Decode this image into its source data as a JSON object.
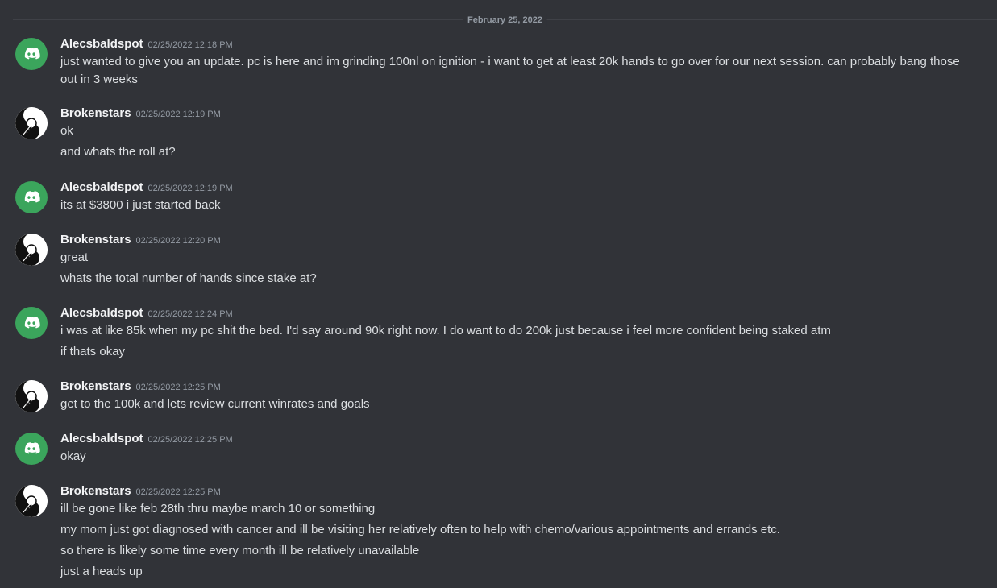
{
  "date_divider": "February 25, 2022",
  "messages": [
    {
      "username": "Alecsbaldspot",
      "timestamp": "02/25/2022 12:18 PM",
      "avatar": "discord-logo-icon",
      "lines": [
        "just wanted to give you an update. pc is here and im grinding 100nl on ignition - i want to get at least 20k hands to go over for our next session. can probably bang those out in 3 weeks"
      ]
    },
    {
      "username": "Brokenstars",
      "timestamp": "02/25/2022 12:19 PM",
      "avatar": "yin-yang-icon",
      "lines": [
        "ok",
        "and whats the roll at?"
      ]
    },
    {
      "username": "Alecsbaldspot",
      "timestamp": "02/25/2022 12:19 PM",
      "avatar": "discord-logo-icon",
      "lines": [
        "its at $3800 i just started back"
      ]
    },
    {
      "username": "Brokenstars",
      "timestamp": "02/25/2022 12:20 PM",
      "avatar": "yin-yang-icon",
      "lines": [
        "great",
        "whats the total number of hands since stake at?"
      ]
    },
    {
      "username": "Alecsbaldspot",
      "timestamp": "02/25/2022 12:24 PM",
      "avatar": "discord-logo-icon",
      "lines": [
        "i was at like 85k when my pc shit the bed. I'd say around 90k right now. I do want to do 200k just because i feel more confident being staked atm",
        "if thats okay"
      ]
    },
    {
      "username": "Brokenstars",
      "timestamp": "02/25/2022 12:25 PM",
      "avatar": "yin-yang-icon",
      "lines": [
        "get to the 100k and lets review current winrates and goals"
      ]
    },
    {
      "username": "Alecsbaldspot",
      "timestamp": "02/25/2022 12:25 PM",
      "avatar": "discord-logo-icon",
      "lines": [
        "okay"
      ]
    },
    {
      "username": "Brokenstars",
      "timestamp": "02/25/2022 12:25 PM",
      "avatar": "yin-yang-icon",
      "lines": [
        "ill be gone like feb 28th thru maybe march 10 or something",
        "my mom just got diagnosed with cancer and ill be visiting her relatively often to help with chemo/various appointments and errands etc.",
        "so there is likely some time every month ill be relatively unavailable",
        "just a heads up"
      ]
    }
  ]
}
